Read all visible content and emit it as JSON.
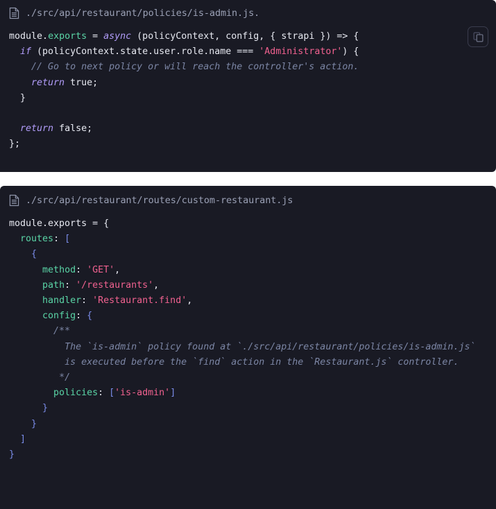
{
  "theme": {
    "page_background": "#ffffff",
    "code_background": "#191A24",
    "default_text": "#e6e8f0",
    "filename_text": "#9aa0b5",
    "property_color": "#5ad4a6",
    "keyword_color": "#b19cf9",
    "string_color": "#f0618f",
    "punctuation_color": "#7a8ce8",
    "comment_color": "#7c86a5",
    "copy_button_border": "#3a3c4d"
  },
  "blocks": [
    {
      "file_icon": "document-icon",
      "filename": "./src/api/restaurant/policies/is-admin.js.",
      "copy_button": {
        "icon": "copy-icon",
        "label": "Copy"
      },
      "language": "javascript",
      "code_lines": [
        [
          {
            "t": "module",
            "c": "plain"
          },
          {
            "t": ".",
            "c": "plain"
          },
          {
            "t": "exports",
            "c": "prop"
          },
          {
            "t": " = ",
            "c": "op"
          },
          {
            "t": "async",
            "c": "key"
          },
          {
            "t": " (policyContext, config, { strapi }) => {",
            "c": "plain"
          }
        ],
        [
          {
            "t": "  ",
            "c": "plain"
          },
          {
            "t": "if",
            "c": "key"
          },
          {
            "t": " (policyContext.state.user.role.name === ",
            "c": "plain"
          },
          {
            "t": "'Administrator'",
            "c": "str"
          },
          {
            "t": ") {",
            "c": "plain"
          }
        ],
        [
          {
            "t": "    ",
            "c": "plain"
          },
          {
            "t": "// Go to next policy or will reach the controller's action.",
            "c": "comment"
          }
        ],
        [
          {
            "t": "    ",
            "c": "plain"
          },
          {
            "t": "return",
            "c": "key"
          },
          {
            "t": " true;",
            "c": "plain"
          }
        ],
        [
          {
            "t": "  }",
            "c": "plain"
          }
        ],
        [
          {
            "t": "",
            "c": "plain"
          }
        ],
        [
          {
            "t": "  ",
            "c": "plain"
          },
          {
            "t": "return",
            "c": "key"
          },
          {
            "t": " false;",
            "c": "plain"
          }
        ],
        [
          {
            "t": "};",
            "c": "plain"
          }
        ]
      ]
    },
    {
      "file_icon": "document-icon",
      "filename": "./src/api/restaurant/routes/custom-restaurant.js",
      "language": "javascript",
      "code_lines": [
        [
          {
            "t": "module.exports = {",
            "c": "plain"
          }
        ],
        [
          {
            "t": "  ",
            "c": "plain"
          },
          {
            "t": "routes",
            "c": "prop"
          },
          {
            "t": ": ",
            "c": "plain"
          },
          {
            "t": "[",
            "c": "punct"
          }
        ],
        [
          {
            "t": "    ",
            "c": "plain"
          },
          {
            "t": "{",
            "c": "punct"
          }
        ],
        [
          {
            "t": "      ",
            "c": "plain"
          },
          {
            "t": "method",
            "c": "prop"
          },
          {
            "t": ": ",
            "c": "plain"
          },
          {
            "t": "'GET'",
            "c": "str"
          },
          {
            "t": ",",
            "c": "plain"
          }
        ],
        [
          {
            "t": "      ",
            "c": "plain"
          },
          {
            "t": "path",
            "c": "prop"
          },
          {
            "t": ": ",
            "c": "plain"
          },
          {
            "t": "'/restaurants'",
            "c": "str"
          },
          {
            "t": ",",
            "c": "plain"
          }
        ],
        [
          {
            "t": "      ",
            "c": "plain"
          },
          {
            "t": "handler",
            "c": "prop"
          },
          {
            "t": ": ",
            "c": "plain"
          },
          {
            "t": "'Restaurant.find'",
            "c": "str"
          },
          {
            "t": ",",
            "c": "plain"
          }
        ],
        [
          {
            "t": "      ",
            "c": "plain"
          },
          {
            "t": "config",
            "c": "prop"
          },
          {
            "t": ": ",
            "c": "plain"
          },
          {
            "t": "{",
            "c": "punct"
          }
        ],
        [
          {
            "t": "        ",
            "c": "plain"
          },
          {
            "t": "/**",
            "c": "comment"
          }
        ],
        [
          {
            "t": "          ",
            "c": "plain"
          },
          {
            "t": "The `is-admin` policy found at `./src/api/restaurant/policies/is-admin.js`",
            "c": "comment"
          }
        ],
        [
          {
            "t": "          ",
            "c": "plain"
          },
          {
            "t": "is executed before the `find` action in the `Restaurant.js` controller.",
            "c": "comment"
          }
        ],
        [
          {
            "t": "         ",
            "c": "plain"
          },
          {
            "t": "*/",
            "c": "comment"
          }
        ],
        [
          {
            "t": "        ",
            "c": "plain"
          },
          {
            "t": "policies",
            "c": "prop"
          },
          {
            "t": ": ",
            "c": "plain"
          },
          {
            "t": "[",
            "c": "punct"
          },
          {
            "t": "'is-admin'",
            "c": "str"
          },
          {
            "t": "]",
            "c": "punct"
          }
        ],
        [
          {
            "t": "      ",
            "c": "plain"
          },
          {
            "t": "}",
            "c": "punct"
          }
        ],
        [
          {
            "t": "    ",
            "c": "plain"
          },
          {
            "t": "}",
            "c": "punct"
          }
        ],
        [
          {
            "t": "  ",
            "c": "plain"
          },
          {
            "t": "]",
            "c": "punct"
          }
        ],
        [
          {
            "t": "}",
            "c": "punct"
          }
        ]
      ]
    }
  ]
}
